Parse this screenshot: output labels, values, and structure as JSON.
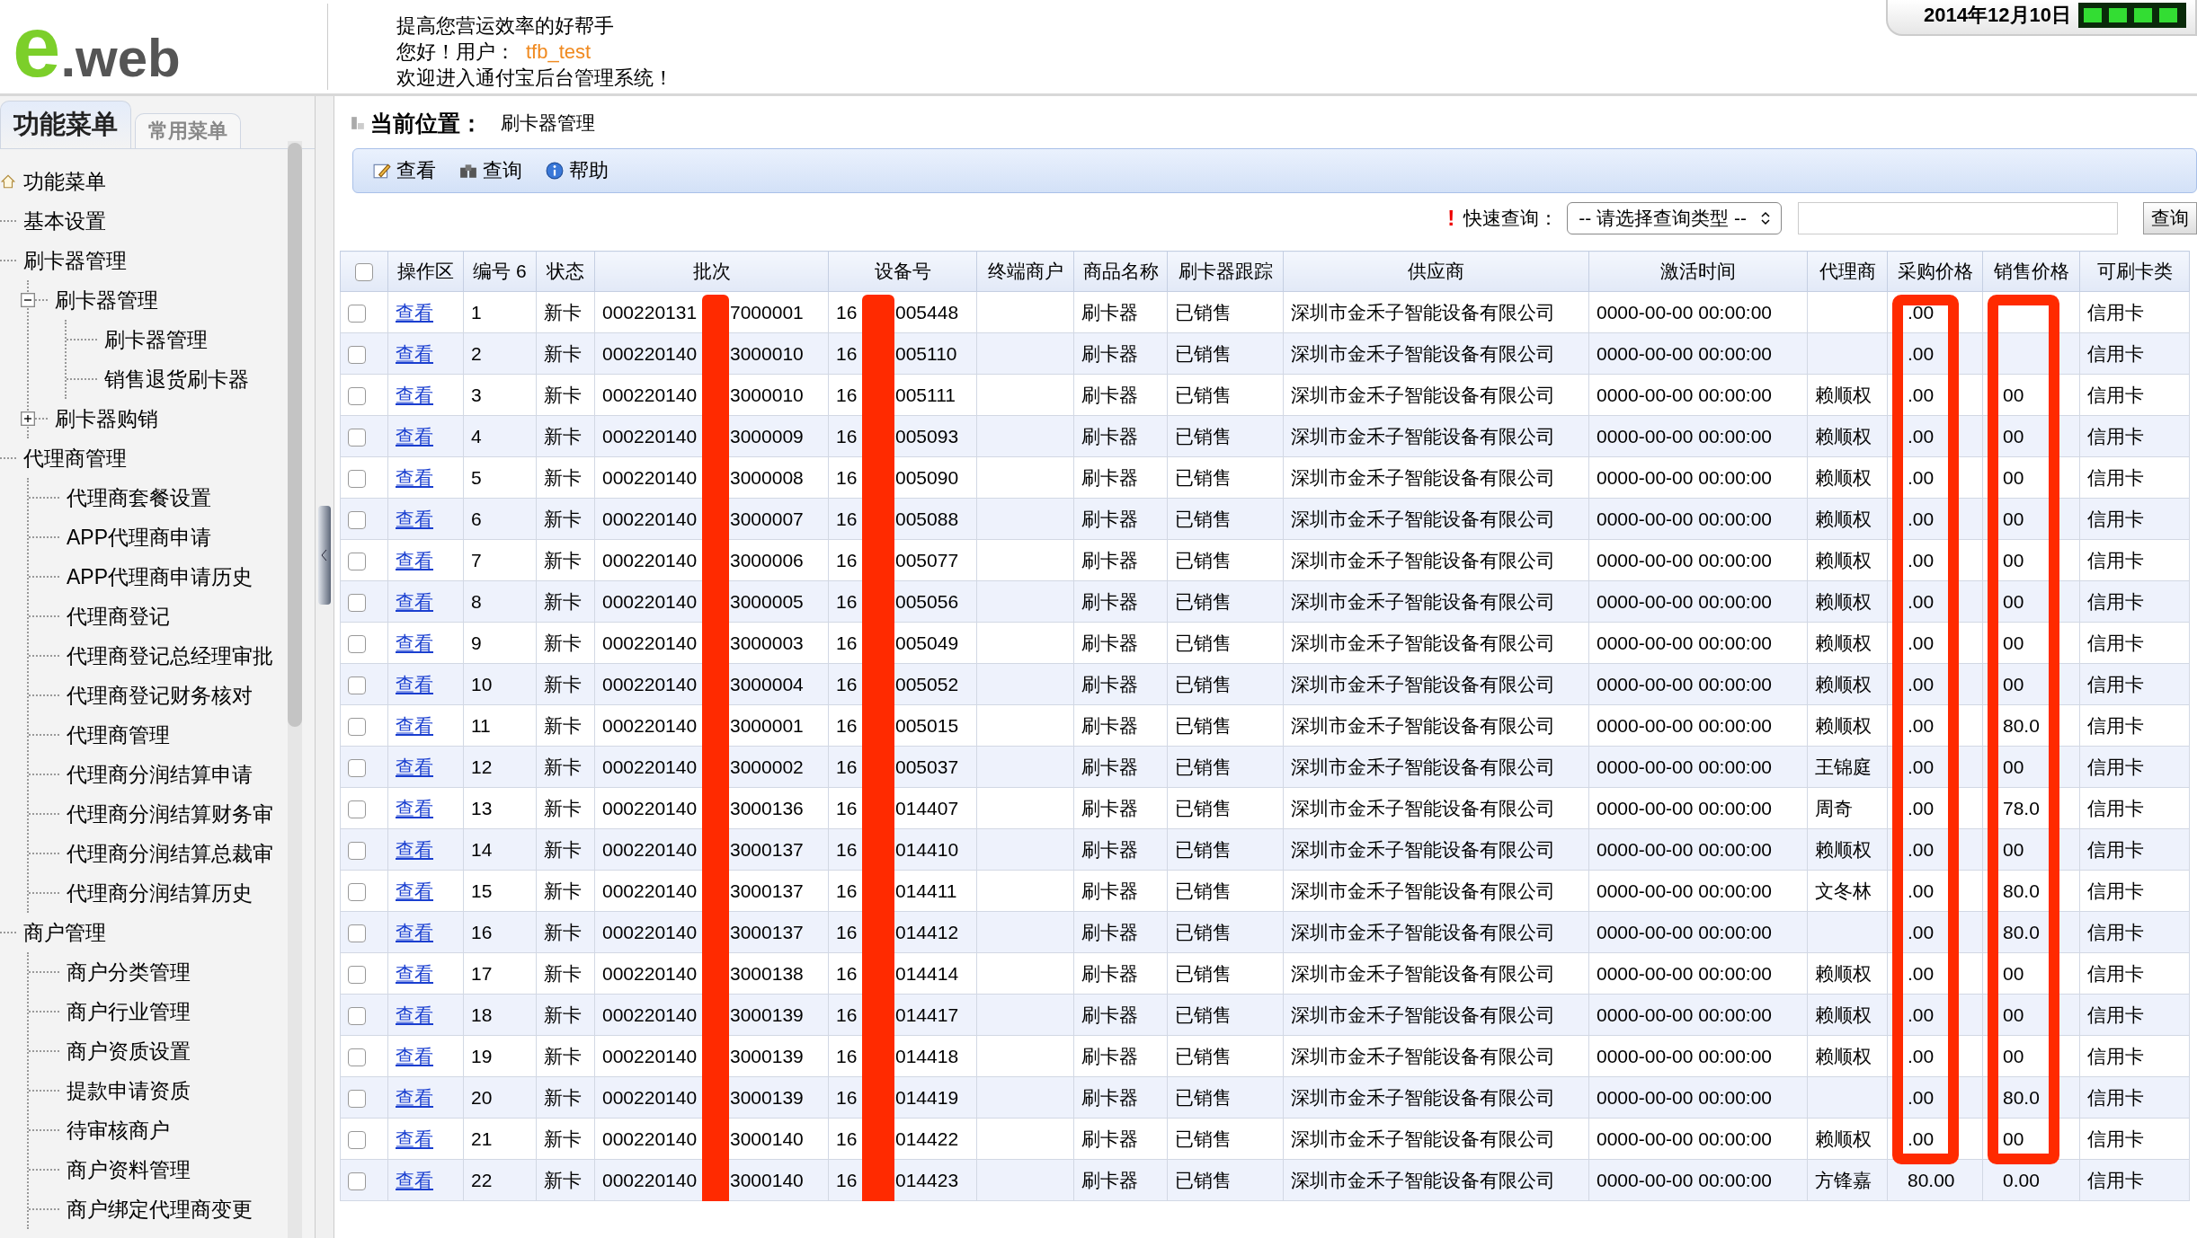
{
  "header": {
    "logo_mark": "e",
    "logo_text": ".web",
    "slogan": "提高您营运效率的好帮手",
    "greeting": "您好！用户：",
    "username": "tfb_test",
    "welcome": "欢迎进入通付宝后台管理系统！",
    "date": "2014年12月10日"
  },
  "sidebar": {
    "tabs": [
      {
        "label": "功能菜单",
        "selected": true
      },
      {
        "label": "常用菜单",
        "selected": false
      }
    ],
    "tree": {
      "label": "功能菜单",
      "children": [
        {
          "label": "基本设置"
        },
        {
          "label": "刷卡器管理",
          "children": [
            {
              "label": "刷卡器管理",
              "expanded": true,
              "children": [
                {
                  "label": "刷卡器管理"
                },
                {
                  "label": "销售退货刷卡器"
                }
              ]
            },
            {
              "label": "刷卡器购销",
              "expanded": false
            }
          ]
        },
        {
          "label": "代理商管理",
          "children": [
            {
              "label": "代理商套餐设置"
            },
            {
              "label": "APP代理商申请"
            },
            {
              "label": "APP代理商申请历史"
            },
            {
              "label": "代理商登记"
            },
            {
              "label": "代理商登记总经理审批"
            },
            {
              "label": "代理商登记财务核对"
            },
            {
              "label": "代理商管理"
            },
            {
              "label": "代理商分润结算申请"
            },
            {
              "label": "代理商分润结算财务审"
            },
            {
              "label": "代理商分润结算总裁审"
            },
            {
              "label": "代理商分润结算历史"
            }
          ]
        },
        {
          "label": "商户管理",
          "children": [
            {
              "label": "商户分类管理"
            },
            {
              "label": "商户行业管理"
            },
            {
              "label": "商户资质设置"
            },
            {
              "label": "提款申请资质"
            },
            {
              "label": "待审核商户"
            },
            {
              "label": "商户资料管理"
            },
            {
              "label": "商户绑定代理商变更"
            }
          ]
        }
      ]
    }
  },
  "breadcrumb": {
    "label": "当前位置：",
    "page": "刷卡器管理"
  },
  "toolbar": [
    {
      "kind": "edit",
      "label": "查看"
    },
    {
      "kind": "binoculars",
      "label": "查询"
    },
    {
      "kind": "info",
      "label": "帮助"
    }
  ],
  "quick_search": {
    "mark": "!",
    "label": "快速查询：",
    "select": "-- 请选择查询类型 --",
    "button": "查询"
  },
  "table": {
    "select_all": {
      "checked": false
    },
    "columns": [
      "操作区",
      "编号 6",
      "状态",
      "批次",
      "设备号",
      "终端商户",
      "商品名称",
      "刷卡器跟踪",
      "供应商",
      "激活时间",
      "代理商",
      "采购价格",
      "销售价格",
      "可刷卡类"
    ],
    "rows": [
      {
        "checked": false,
        "action": "查看",
        "no": "1",
        "status": "新卡",
        "batch": [
          "000220131",
          "7000001"
        ],
        "device": [
          "16",
          "005448"
        ],
        "product": "刷卡器",
        "tracking": "已销售",
        "supplier": "深圳市金禾子智能设备有限公司",
        "activated": "0000-00-00 00:00:00",
        "buy": ".00",
        "card": "信用卡"
      },
      {
        "checked": false,
        "action": "查看",
        "no": "2",
        "status": "新卡",
        "batch": [
          "000220140",
          "3000010"
        ],
        "device": [
          "16",
          "005110"
        ],
        "product": "刷卡器",
        "tracking": "已销售",
        "supplier": "深圳市金禾子智能设备有限公司",
        "activated": "0000-00-00 00:00:00",
        "buy": ".00",
        "card": "信用卡"
      },
      {
        "checked": false,
        "action": "查看",
        "no": "3",
        "status": "新卡",
        "batch": [
          "000220140",
          "3000010"
        ],
        "device": [
          "16",
          "005111"
        ],
        "product": "刷卡器",
        "tracking": "已销售",
        "supplier": "深圳市金禾子智能设备有限公司",
        "activated": "0000-00-00 00:00:00",
        "agent": "赖顺权",
        "buy": ".00",
        "sell": "00",
        "card": "信用卡"
      },
      {
        "checked": false,
        "action": "查看",
        "no": "4",
        "status": "新卡",
        "batch": [
          "000220140",
          "3000009"
        ],
        "device": [
          "16",
          "005093"
        ],
        "product": "刷卡器",
        "tracking": "已销售",
        "supplier": "深圳市金禾子智能设备有限公司",
        "activated": "0000-00-00 00:00:00",
        "agent": "赖顺权",
        "buy": ".00",
        "sell": "00",
        "card": "信用卡"
      },
      {
        "checked": false,
        "action": "查看",
        "no": "5",
        "status": "新卡",
        "batch": [
          "000220140",
          "3000008"
        ],
        "device": [
          "16",
          "005090"
        ],
        "product": "刷卡器",
        "tracking": "已销售",
        "supplier": "深圳市金禾子智能设备有限公司",
        "activated": "0000-00-00 00:00:00",
        "agent": "赖顺权",
        "buy": ".00",
        "sell": "00",
        "card": "信用卡"
      },
      {
        "checked": false,
        "action": "查看",
        "no": "6",
        "status": "新卡",
        "batch": [
          "000220140",
          "3000007"
        ],
        "device": [
          "16",
          "005088"
        ],
        "product": "刷卡器",
        "tracking": "已销售",
        "supplier": "深圳市金禾子智能设备有限公司",
        "activated": "0000-00-00 00:00:00",
        "agent": "赖顺权",
        "buy": ".00",
        "sell": "00",
        "card": "信用卡"
      },
      {
        "checked": false,
        "action": "查看",
        "no": "7",
        "status": "新卡",
        "batch": [
          "000220140",
          "3000006"
        ],
        "device": [
          "16",
          "005077"
        ],
        "product": "刷卡器",
        "tracking": "已销售",
        "supplier": "深圳市金禾子智能设备有限公司",
        "activated": "0000-00-00 00:00:00",
        "agent": "赖顺权",
        "buy": ".00",
        "sell": "00",
        "card": "信用卡"
      },
      {
        "checked": false,
        "action": "查看",
        "no": "8",
        "status": "新卡",
        "batch": [
          "000220140",
          "3000005"
        ],
        "device": [
          "16",
          "005056"
        ],
        "product": "刷卡器",
        "tracking": "已销售",
        "supplier": "深圳市金禾子智能设备有限公司",
        "activated": "0000-00-00 00:00:00",
        "agent": "赖顺权",
        "buy": ".00",
        "sell": "00",
        "card": "信用卡"
      },
      {
        "checked": false,
        "action": "查看",
        "no": "9",
        "status": "新卡",
        "batch": [
          "000220140",
          "3000003"
        ],
        "device": [
          "16",
          "005049"
        ],
        "product": "刷卡器",
        "tracking": "已销售",
        "supplier": "深圳市金禾子智能设备有限公司",
        "activated": "0000-00-00 00:00:00",
        "agent": "赖顺权",
        "buy": ".00",
        "sell": "00",
        "card": "信用卡"
      },
      {
        "checked": false,
        "action": "查看",
        "no": "10",
        "status": "新卡",
        "batch": [
          "000220140",
          "3000004"
        ],
        "device": [
          "16",
          "005052"
        ],
        "product": "刷卡器",
        "tracking": "已销售",
        "supplier": "深圳市金禾子智能设备有限公司",
        "activated": "0000-00-00 00:00:00",
        "agent": "赖顺权",
        "buy": ".00",
        "sell": "00",
        "card": "信用卡"
      },
      {
        "checked": false,
        "action": "查看",
        "no": "11",
        "status": "新卡",
        "batch": [
          "000220140",
          "3000001"
        ],
        "device": [
          "16",
          "005015"
        ],
        "product": "刷卡器",
        "tracking": "已销售",
        "supplier": "深圳市金禾子智能设备有限公司",
        "activated": "0000-00-00 00:00:00",
        "agent": "赖顺权",
        "buy": ".00",
        "sell": "80.0",
        "card": "信用卡"
      },
      {
        "checked": false,
        "action": "查看",
        "no": "12",
        "status": "新卡",
        "batch": [
          "000220140",
          "3000002"
        ],
        "device": [
          "16",
          "005037"
        ],
        "product": "刷卡器",
        "tracking": "已销售",
        "supplier": "深圳市金禾子智能设备有限公司",
        "activated": "0000-00-00 00:00:00",
        "agent": "王锦庭",
        "buy": ".00",
        "sell": "00",
        "card": "信用卡"
      },
      {
        "checked": false,
        "action": "查看",
        "no": "13",
        "status": "新卡",
        "batch": [
          "000220140",
          "3000136"
        ],
        "device": [
          "16",
          "014407"
        ],
        "product": "刷卡器",
        "tracking": "已销售",
        "supplier": "深圳市金禾子智能设备有限公司",
        "activated": "0000-00-00 00:00:00",
        "agent": "周奇",
        "buy": ".00",
        "sell": "78.0",
        "card": "信用卡"
      },
      {
        "checked": false,
        "action": "查看",
        "no": "14",
        "status": "新卡",
        "batch": [
          "000220140",
          "3000137"
        ],
        "device": [
          "16",
          "014410"
        ],
        "product": "刷卡器",
        "tracking": "已销售",
        "supplier": "深圳市金禾子智能设备有限公司",
        "activated": "0000-00-00 00:00:00",
        "agent": "赖顺权",
        "buy": ".00",
        "sell": "00",
        "card": "信用卡"
      },
      {
        "checked": false,
        "action": "查看",
        "no": "15",
        "status": "新卡",
        "batch": [
          "000220140",
          "3000137"
        ],
        "device": [
          "16",
          "014411"
        ],
        "product": "刷卡器",
        "tracking": "已销售",
        "supplier": "深圳市金禾子智能设备有限公司",
        "activated": "0000-00-00 00:00:00",
        "agent": "文冬林",
        "buy": ".00",
        "sell": "80.0",
        "card": "信用卡"
      },
      {
        "checked": false,
        "action": "查看",
        "no": "16",
        "status": "新卡",
        "batch": [
          "000220140",
          "3000137"
        ],
        "device": [
          "16",
          "014412"
        ],
        "product": "刷卡器",
        "tracking": "已销售",
        "supplier": "深圳市金禾子智能设备有限公司",
        "activated": "0000-00-00 00:00:00",
        "buy": ".00",
        "sell": "80.0",
        "card": "信用卡"
      },
      {
        "checked": false,
        "action": "查看",
        "no": "17",
        "status": "新卡",
        "batch": [
          "000220140",
          "3000138"
        ],
        "device": [
          "16",
          "014414"
        ],
        "product": "刷卡器",
        "tracking": "已销售",
        "supplier": "深圳市金禾子智能设备有限公司",
        "activated": "0000-00-00 00:00:00",
        "agent": "赖顺权",
        "buy": ".00",
        "sell": "00",
        "card": "信用卡"
      },
      {
        "checked": false,
        "action": "查看",
        "no": "18",
        "status": "新卡",
        "batch": [
          "000220140",
          "3000139"
        ],
        "device": [
          "16",
          "014417"
        ],
        "product": "刷卡器",
        "tracking": "已销售",
        "supplier": "深圳市金禾子智能设备有限公司",
        "activated": "0000-00-00 00:00:00",
        "agent": "赖顺权",
        "buy": ".00",
        "sell": "00",
        "card": "信用卡"
      },
      {
        "checked": false,
        "action": "查看",
        "no": "19",
        "status": "新卡",
        "batch": [
          "000220140",
          "3000139"
        ],
        "device": [
          "16",
          "014418"
        ],
        "product": "刷卡器",
        "tracking": "已销售",
        "supplier": "深圳市金禾子智能设备有限公司",
        "activated": "0000-00-00 00:00:00",
        "agent": "赖顺权",
        "buy": ".00",
        "sell": "00",
        "card": "信用卡"
      },
      {
        "checked": false,
        "action": "查看",
        "no": "20",
        "status": "新卡",
        "batch": [
          "000220140",
          "3000139"
        ],
        "device": [
          "16",
          "014419"
        ],
        "product": "刷卡器",
        "tracking": "已销售",
        "supplier": "深圳市金禾子智能设备有限公司",
        "activated": "0000-00-00 00:00:00",
        "buy": ".00",
        "sell": "80.0",
        "card": "信用卡"
      },
      {
        "checked": false,
        "action": "查看",
        "no": "21",
        "status": "新卡",
        "batch": [
          "000220140",
          "3000140"
        ],
        "device": [
          "16",
          "014422"
        ],
        "product": "刷卡器",
        "tracking": "已销售",
        "supplier": "深圳市金禾子智能设备有限公司",
        "activated": "0000-00-00 00:00:00",
        "agent": "赖顺权",
        "buy": ".00",
        "sell": "00",
        "card": "信用卡"
      },
      {
        "checked": false,
        "action": "查看",
        "no": "22",
        "status": "新卡",
        "batch": [
          "000220140",
          "3000140"
        ],
        "device": [
          "16",
          "014423"
        ],
        "product": "刷卡器",
        "tracking": "已销售",
        "supplier": "深圳市金禾子智能设备有限公司",
        "activated": "0000-00-00 00:00:00",
        "agent": "方锋嘉",
        "buy": "80.00",
        "sell": "0.00",
        "card": "信用卡"
      }
    ]
  }
}
